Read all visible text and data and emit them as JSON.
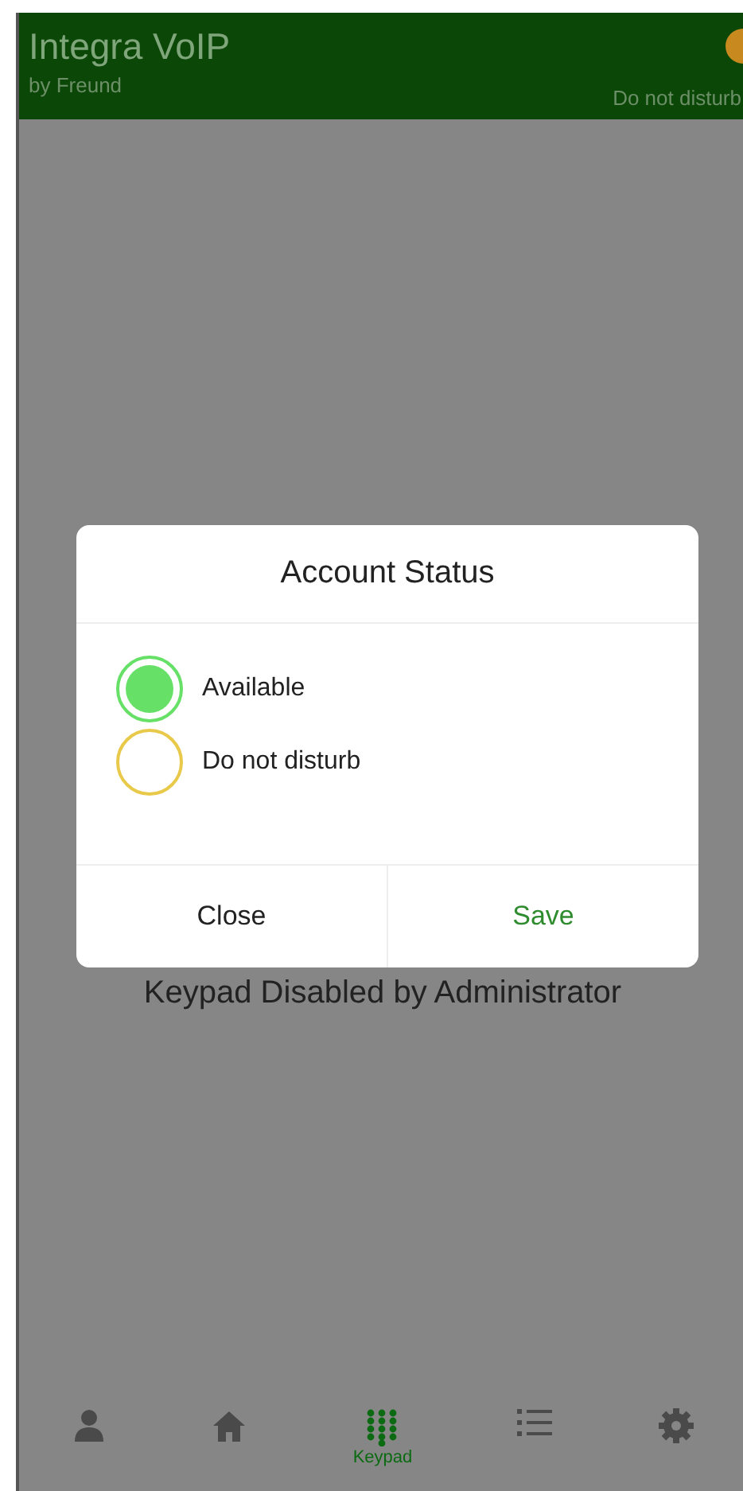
{
  "header": {
    "title": "Integra VoIP",
    "subtitle": "by Freund",
    "status": {
      "label": "Do not disturb",
      "color": "#c88a1e"
    }
  },
  "message": "Keypad Disabled by Administrator",
  "dialog": {
    "title": "Account Status",
    "options": [
      {
        "label": "Available",
        "selected": true,
        "color": "#66e066"
      },
      {
        "label": "Do not disturb",
        "selected": false,
        "color": "#e8c94a"
      }
    ],
    "buttons": [
      {
        "label": "Close",
        "kind": "cancel"
      },
      {
        "label": "Save",
        "kind": "confirm"
      }
    ]
  },
  "nav": [
    {
      "kind": "person",
      "selected": false
    },
    {
      "kind": "home",
      "selected": false
    },
    {
      "kind": "keypad",
      "label": "Keypad",
      "selected": true
    },
    {
      "kind": "list",
      "selected": false
    },
    {
      "kind": "gear",
      "selected": false
    }
  ]
}
